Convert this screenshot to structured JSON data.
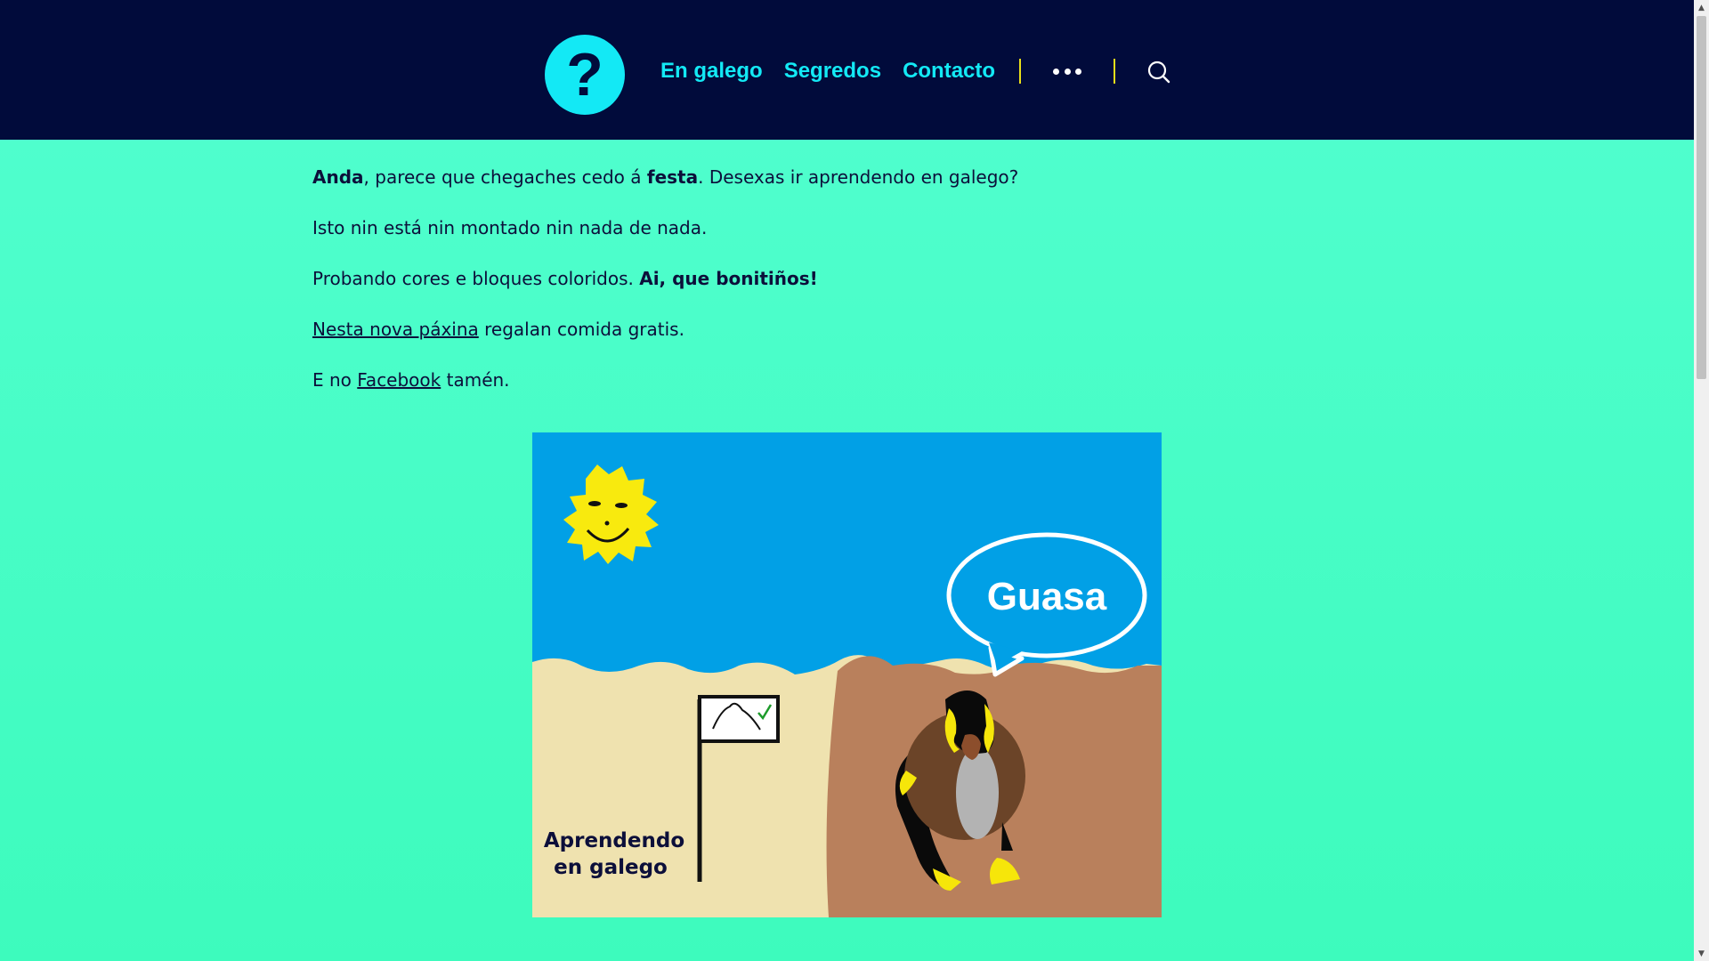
{
  "header": {
    "logo_glyph": "?",
    "nav": [
      {
        "label": "En galego"
      },
      {
        "label": "Segredos"
      },
      {
        "label": "Contacto"
      }
    ],
    "more_icon": "ellipsis-icon",
    "search_icon": "search-icon"
  },
  "content": {
    "p1": {
      "b1": "Anda",
      "t1": ", parece que chegaches cedo á ",
      "b2": "festa",
      "t2": ". Desexas ir aprendendo en galego?"
    },
    "p2": "Isto nin está nin montado nin nada de nada.",
    "p3": {
      "t1": "Probando cores e bloques coloridos. ",
      "b1": "Ai, que bonitiños!"
    },
    "p4": {
      "link": "Nesta nova páxina",
      "t1": " regalan comida gratis."
    },
    "p5": {
      "t1": "E no ",
      "link": "Facebook",
      "t2": " tamén."
    }
  },
  "illustration": {
    "speech": "Guasa",
    "sign_line1": "Aprendendo",
    "sign_line2": "en galego"
  },
  "colors": {
    "header_bg": "#010b3b",
    "accent": "#13e9f5",
    "page_bg": "#4dfecd",
    "separator": "#e8df1a"
  }
}
